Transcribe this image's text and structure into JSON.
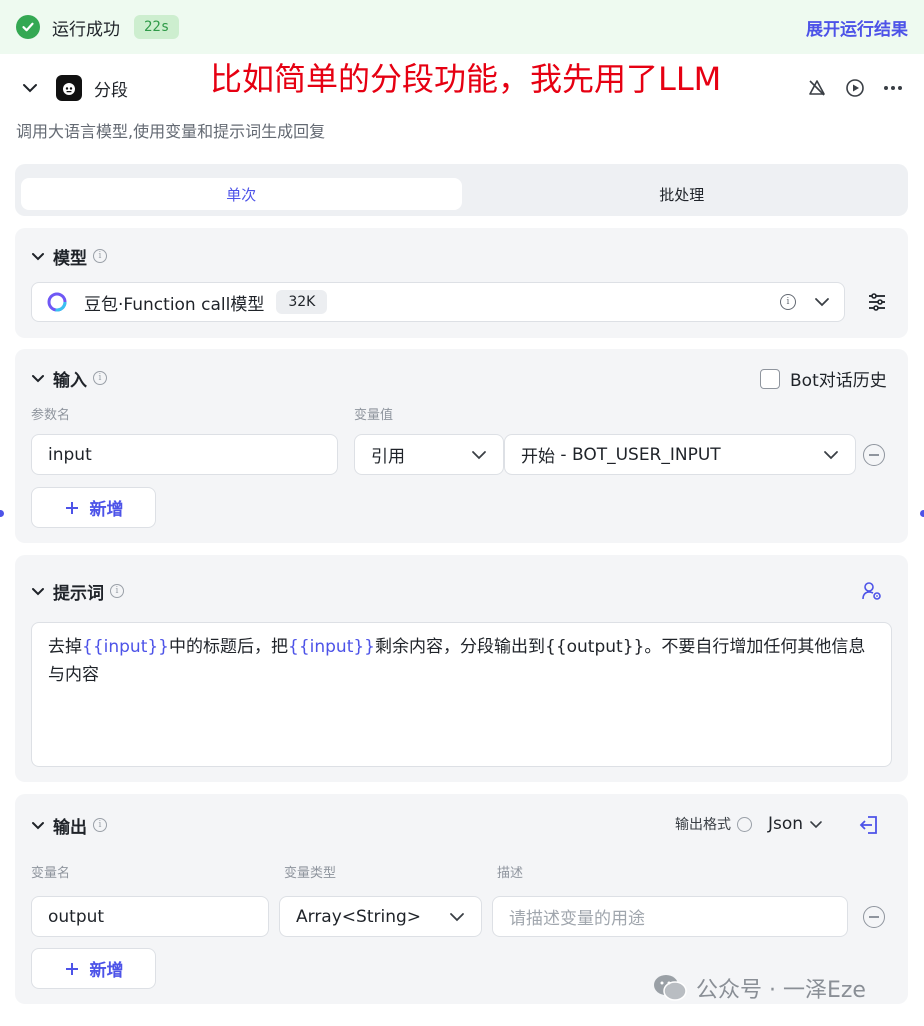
{
  "banner": {
    "status": "运行成功",
    "duration": "22s",
    "expand": "展开运行结果"
  },
  "node": {
    "title": "分段",
    "annotation": "比如简单的分段功能，我先用了LLM",
    "description": "调用大语言模型,使用变量和提示词生成回复"
  },
  "tabs": [
    {
      "label": "单次",
      "active": true
    },
    {
      "label": "批处理",
      "active": false
    }
  ],
  "model": {
    "section_title": "模型",
    "name": "豆包·Function call模型",
    "context": "32K"
  },
  "input": {
    "section_title": "输入",
    "bot_history_label": "Bot对话历史",
    "bot_history_checked": false,
    "param_name_label": "参数名",
    "var_value_label": "变量值",
    "param_name": "input",
    "ref_type": "引用",
    "ref_source": "开始",
    "ref_sep": " - ",
    "ref_var": "BOT_USER_INPUT",
    "add_label": "新增"
  },
  "prompt": {
    "section_title": "提示词",
    "text_1": "去掉",
    "var_1": "{{input}}",
    "text_2": "中的标题后，把",
    "var_2": "{{input}}",
    "text_3": "剩余内容，分段输出到{{output}}。不要自行增加任何其他信息与内容"
  },
  "output": {
    "section_title": "输出",
    "format_label": "输出格式",
    "format_value": "Json",
    "col_name": "变量名",
    "col_type": "变量类型",
    "col_desc": "描述",
    "var_name": "output",
    "var_type": "Array<String>",
    "desc_placeholder": "请描述变量的用途",
    "add_label": "新增"
  },
  "watermark": "公众号 · 一泽Eze",
  "colors": {
    "accent": "#4d53e8",
    "success": "#34a853",
    "annotation": "#e60012",
    "panel_bg": "#f4f5f7"
  },
  "icons": [
    "check-circle-icon",
    "chevron-down-icon",
    "robot-icon",
    "bell-off-icon",
    "play-icon",
    "more-icon",
    "info-icon",
    "model-logo-icon",
    "settings-sliders-icon",
    "plus-icon",
    "minus-circle-icon",
    "user-settings-icon",
    "export-icon",
    "wechat-icon"
  ]
}
